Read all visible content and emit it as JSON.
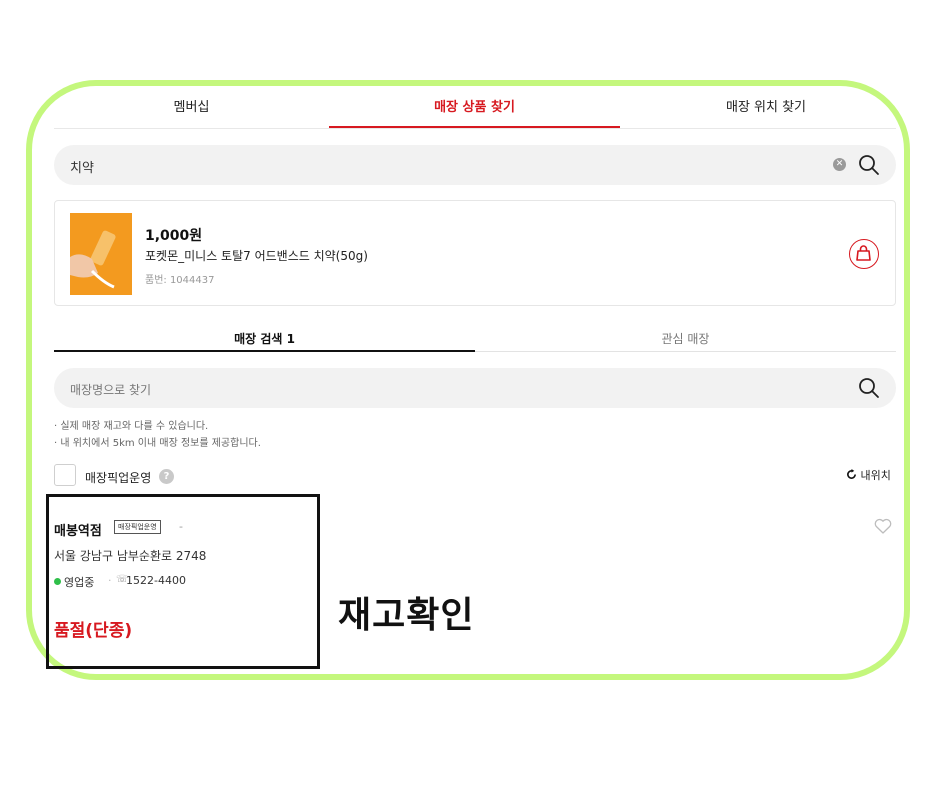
{
  "tabs": [
    "멤버십",
    "매장 상품 찾기",
    "매장 위치 찾기"
  ],
  "search": {
    "value": "치약"
  },
  "product": {
    "price": "1,000원",
    "name": "포켓몬_미니스 토탈7 어드밴스드 치약(50g)",
    "code": "품번: 1044437"
  },
  "sub_tabs": [
    "매장 검색 1",
    "관심 매장"
  ],
  "store_search": {
    "placeholder": "매장명으로 찾기"
  },
  "notes": [
    "· 실제 매장 재고와 다를 수 있습니다.",
    "· 내 위치에서 5km 이내 매장 정보를 제공합니다."
  ],
  "filter": {
    "label": "매장픽업운영",
    "help": "?",
    "my_location": "내위치"
  },
  "store": {
    "name": "매봉역점",
    "badge": "매장픽업운영",
    "dash": "-",
    "address": "서울 강남구 남부순환로 2748",
    "status": "영업중",
    "separator": "·",
    "phone": "1522-4400",
    "stock": "품절(단종)"
  },
  "callout": "재고확인",
  "colors": {
    "accent": "#d71920",
    "frame": "#c4f77d",
    "open": "#2fbf4a"
  }
}
